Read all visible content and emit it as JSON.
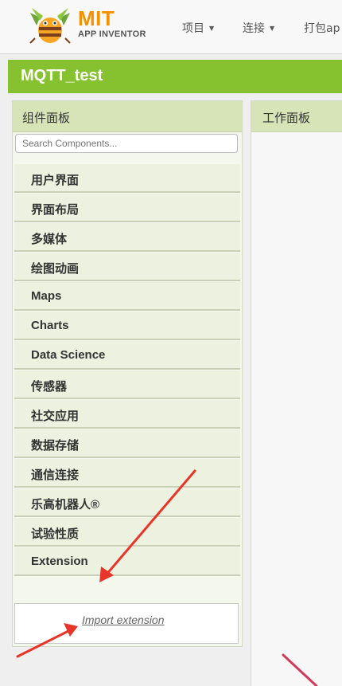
{
  "header": {
    "logo_title": "MIT",
    "logo_subtitle": "APP INVENTOR",
    "menu": [
      {
        "label": "项目",
        "caret": "▼"
      },
      {
        "label": "连接",
        "caret": "▼"
      },
      {
        "label": "打包ap"
      }
    ]
  },
  "project": {
    "name": "MQTT_test"
  },
  "palette": {
    "title": "组件面板",
    "search_placeholder": "Search Components...",
    "categories": [
      "用户界面",
      "界面布局",
      "多媒体",
      "绘图动画",
      "Maps",
      "Charts",
      "Data Science",
      "传感器",
      "社交应用",
      "数据存储",
      "通信连接",
      "乐高机器人®",
      "试验性质",
      "Extension"
    ],
    "import_link": "Import extension"
  },
  "viewer": {
    "title": "工作面板"
  },
  "colors": {
    "title_bar": "#86c12f",
    "panel_header": "#d6e4b7",
    "annotation_arrow": "#e8352a"
  }
}
